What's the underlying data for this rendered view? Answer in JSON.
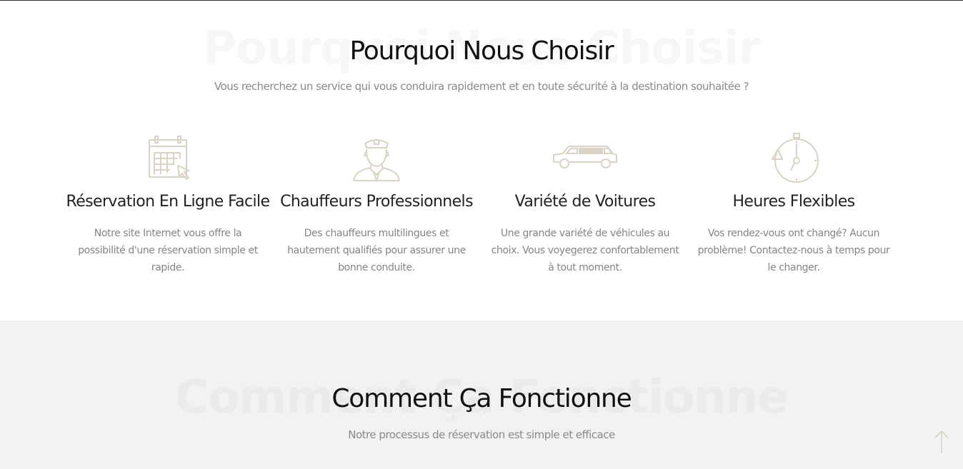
{
  "colors": {
    "accent": "#d8d3c4",
    "heading": "#111111",
    "text_muted": "#858585",
    "section_alt_bg": "#f2f2f2"
  },
  "why": {
    "bg_title": "Pourquoi Nous Choisir",
    "title": "Pourquoi Nous Choisir",
    "subtitle": "Vous recherchez un service qui vous conduira rapidement et en toute sécurité à la destination souhaitée ?",
    "features": [
      {
        "icon": "calendar-icon",
        "title": "Réservation En Ligne Facile",
        "description": "Notre site Internet vous offre la possibilité d'une réservation simple et rapide."
      },
      {
        "icon": "chauffeur-icon",
        "title": "Chauffeurs Professionnels",
        "description": "Des chauffeurs multilingues et hautement qualifiés pour assurer une bonne conduite."
      },
      {
        "icon": "limousine-icon",
        "title": "Variété de Voitures",
        "description": "Une grande variété de véhicules au choix. Vous voyegerez confortablement à tout moment."
      },
      {
        "icon": "stopwatch-icon",
        "title": "Heures Flexibles",
        "description": "Vos rendez-vous ont changé? Aucun problème! Contactez-nous à temps pour le changer."
      }
    ]
  },
  "how": {
    "bg_title": "Comment Ça Fonctionne",
    "title": "Comment Ça Fonctionne",
    "subtitle": "Notre processus de réservation est simple et efficace"
  },
  "scroll_top": {
    "icon": "arrow-up-icon"
  }
}
